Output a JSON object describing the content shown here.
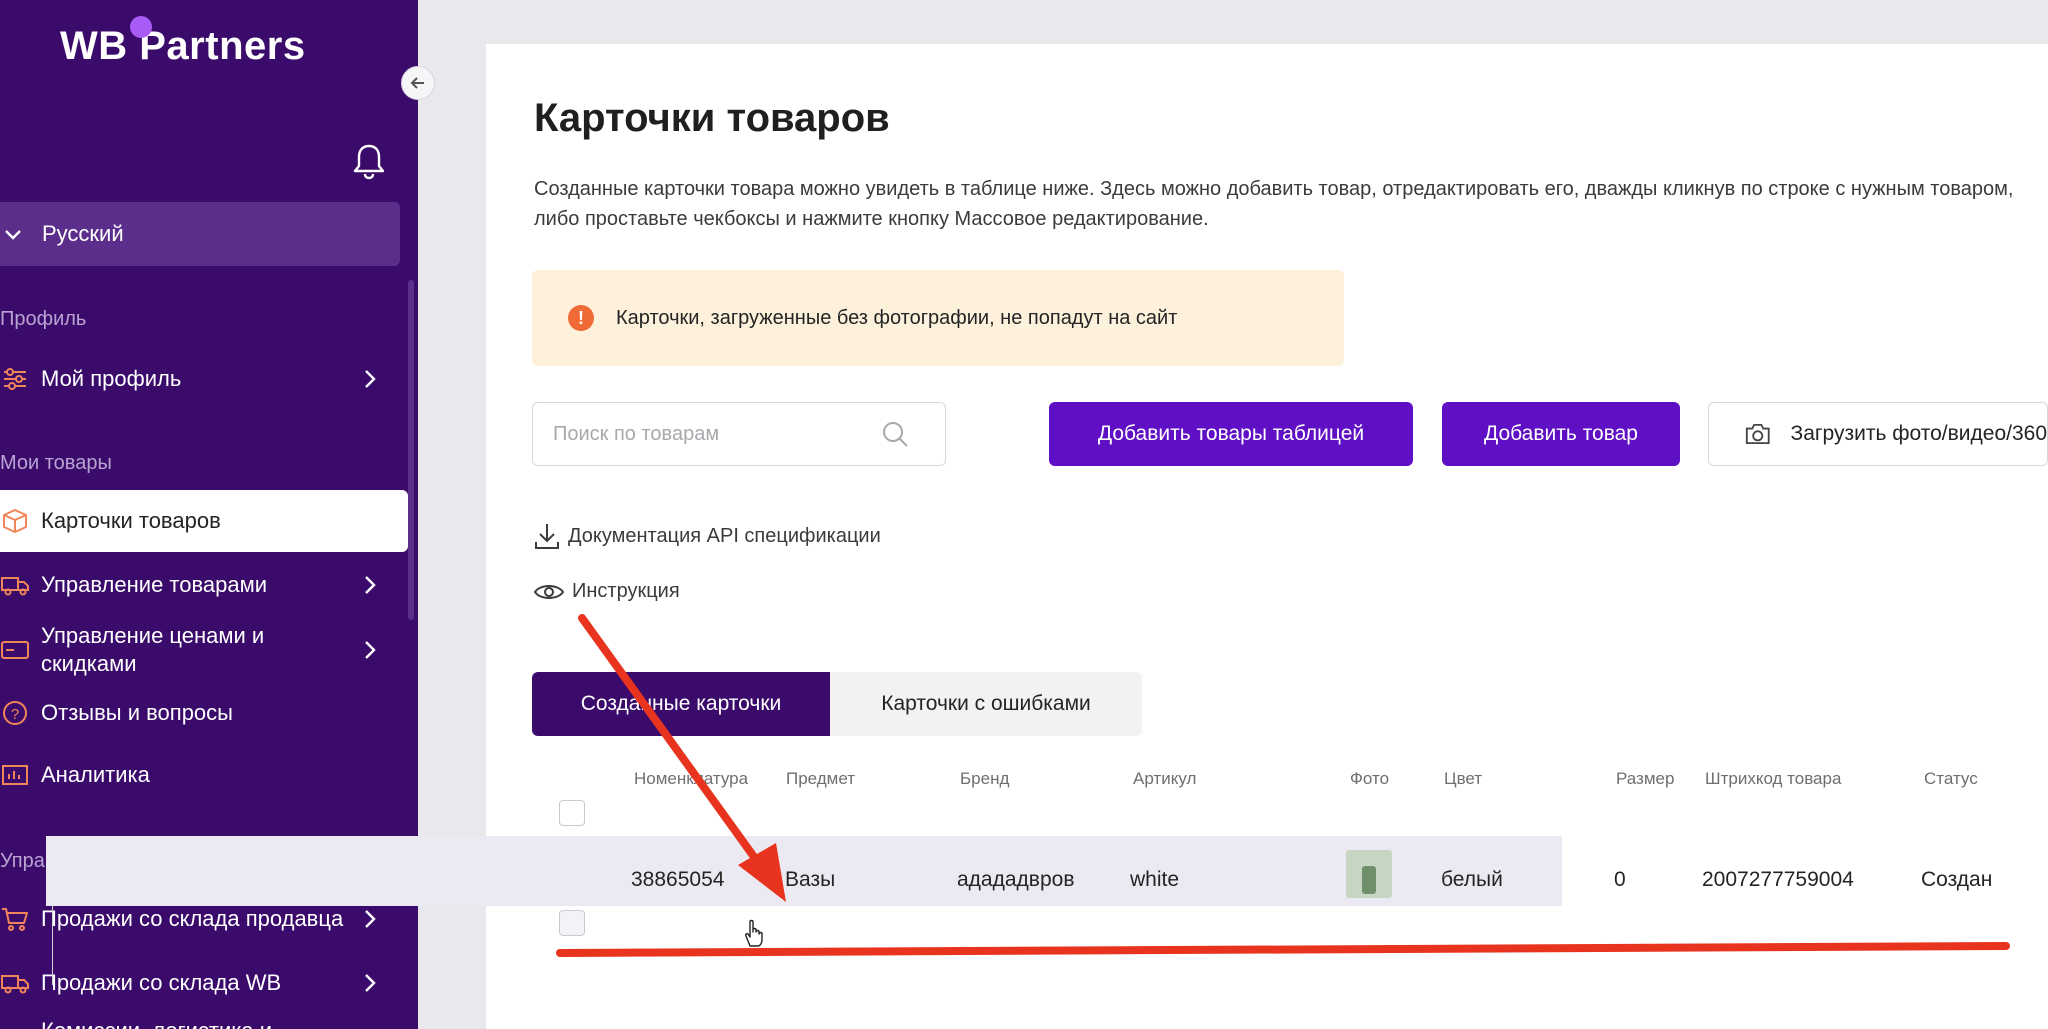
{
  "sidebar": {
    "logo": "WB Partners",
    "language": "Русский",
    "sections": {
      "profile": "Профиль",
      "my_goods": "Мои товары",
      "supply": "Управление поставками"
    },
    "items": {
      "my_profile": "Мой профиль",
      "cards": "Карточки товаров",
      "goods_management": "Управление товарами",
      "prices": "Управление ценами и скидками",
      "reviews": "Отзывы и вопросы",
      "analytics": "Аналитика",
      "seller_sales": "Продажи со склада продавца",
      "wb_sales": "Продажи со склада WB",
      "next_partial": "Комиссии, логистика и"
    }
  },
  "main": {
    "title": "Карточки товаров",
    "description": "Созданные карточки товара можно увидеть в таблице ниже. Здесь можно добавить товар, отредактировать его, дважды кликнув по строке с нужным товаром, либо проставьте чекбоксы и нажмите кнопку Массовое редактирование.",
    "notice": "Карточки, загруженные без фотографии, не попадут на сайт",
    "search_placeholder": "Поиск по товарам",
    "buttons": {
      "add_table": "Добавить товары таблицей",
      "add_item": "Добавить товар",
      "upload_media": "Загрузить фото/видео/360"
    },
    "links": {
      "api_docs": "Документация API спецификации",
      "instruction": "Инструкция"
    },
    "tabs": {
      "created": "Созданные карточки",
      "errors": "Карточки с ошибками"
    }
  },
  "table": {
    "columns": {
      "nomenclature": "Номенклатура",
      "subject": "Предмет",
      "brand": "Бренд",
      "article": "Артикул",
      "photo": "Фото",
      "color": "Цвет",
      "size": "Размер",
      "barcode": "Штрихкод товара",
      "status": "Статус"
    },
    "rows": [
      {
        "nomenclature": "38865054",
        "subject": "Вазы",
        "brand": "адададвров",
        "article": "white",
        "color": "белый",
        "size": "0",
        "barcode": "2007277759004",
        "status": "Создан"
      }
    ]
  },
  "colors": {
    "sidebar": "#3b0b6c",
    "primary": "#5f0fc4",
    "annotation": "#e8341e"
  }
}
